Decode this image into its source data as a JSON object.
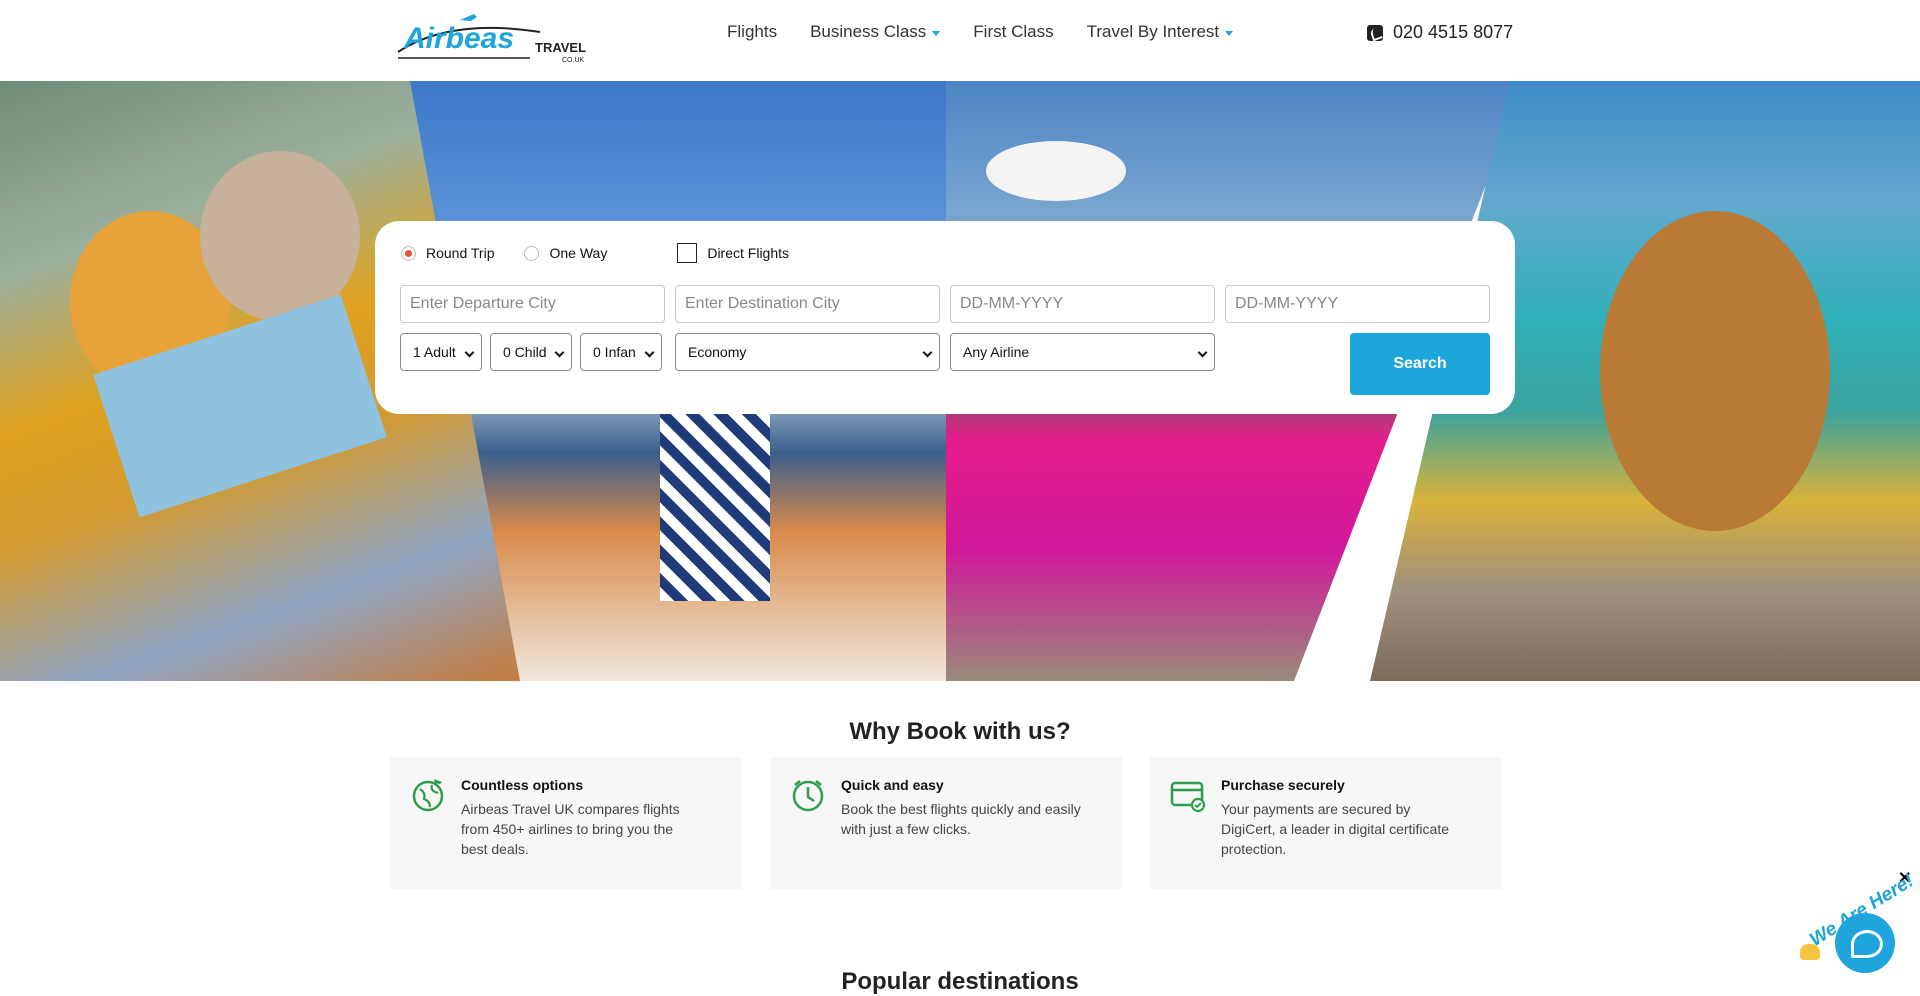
{
  "header": {
    "nav": [
      {
        "label": "Flights",
        "dropdown": false
      },
      {
        "label": "Business Class",
        "dropdown": true
      },
      {
        "label": "First Class",
        "dropdown": false
      },
      {
        "label": "Travel By Interest",
        "dropdown": true
      }
    ],
    "phone": "020 4515 8077",
    "logo": {
      "main": "Airbeas",
      "sub": "TRAVEL",
      "domain": "CO.UK"
    }
  },
  "search": {
    "trip_types": [
      {
        "label": "Round Trip",
        "checked": true
      },
      {
        "label": "One Way",
        "checked": false
      }
    ],
    "direct_flights_label": "Direct Flights",
    "direct_flights_checked": false,
    "departure_placeholder": "Enter Departure City",
    "destination_placeholder": "Enter Destination City",
    "depart_date_placeholder": "DD-MM-YYYY",
    "return_date_placeholder": "DD-MM-YYYY",
    "adults": "1 Adult",
    "children": "0 Child",
    "infants": "0 Infan",
    "cabin": "Economy",
    "airline": "Any Airline",
    "button": "Search"
  },
  "why": {
    "title": "Why Book with us?",
    "features": [
      {
        "icon": "globe-icon",
        "title": "Countless options",
        "text": "Airbeas Travel UK compares flights from 450+ airlines to bring you the best deals."
      },
      {
        "icon": "clock-icon",
        "title": "Quick and easy",
        "text": "Book the best flights quickly and easily with just a few clicks."
      },
      {
        "icon": "secure-card-icon",
        "title": "Purchase securely",
        "text": "Your payments are secured by DigiCert, a leader in digital certificate protection."
      }
    ]
  },
  "popular_title": "Popular destinations",
  "chat": {
    "tag": "We Are Here!",
    "close": "✕"
  },
  "colors": {
    "accent": "#1ea5dc",
    "radio": "#e7553a",
    "icon_green": "#2e9e4e"
  }
}
